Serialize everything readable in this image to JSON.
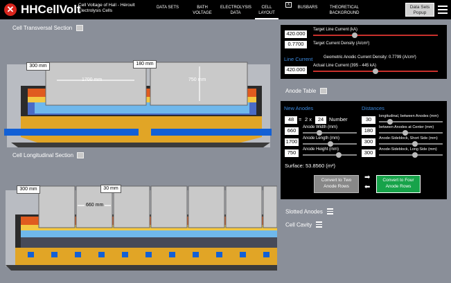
{
  "app": {
    "brand": "HHCellVolt",
    "subtitle": "Cell Voltage of Hall - Héroult Electrolysis Cells"
  },
  "nav": {
    "tabs": [
      {
        "label": "DATA SETS"
      },
      {
        "label": "BATH VOLTAGE"
      },
      {
        "label": "ELECTROLYSIS DATA"
      },
      {
        "label": "CELL LAYOUT"
      },
      {
        "label": "BUSBARS"
      },
      {
        "label": "THEORETICAL BACKGROUND"
      }
    ],
    "close_label": "X",
    "popup_button": "Data Sets Popup"
  },
  "transversal": {
    "title": "Cell Transversal Section",
    "dims": {
      "left_gap": "300 mm",
      "center_gap": "180 mm",
      "anode_width": "1700 mm",
      "anode_height": "750 mm"
    }
  },
  "longitudinal": {
    "title": "Cell Longitudinal Section",
    "dims": {
      "end_gap": "300 mm",
      "between_gap": "30 mm",
      "anode_length": "660 mm"
    }
  },
  "current_panel": {
    "line_current": {
      "value": "420.000",
      "label": "Target Line Current (kA)",
      "fill": 0.65
    },
    "current_density": {
      "value": "0.7700",
      "label": "Target Current Density (A/cm²)",
      "fill": 0.45
    },
    "mode_label": "Line Current",
    "geo_density": "Geometric Anodic Current Density: 0.7799 (A/cm²)",
    "actual": {
      "value": "420.000",
      "label": "Actual Line Current (395 - 445 kA)",
      "fill": 0.5
    }
  },
  "anode_table": {
    "title": "Anode Table",
    "new_anodes_title": "New Anodes",
    "distances_title": "Distances",
    "count_a": "48",
    "equals": "=",
    "times": "2 x",
    "count_b": "24",
    "number_label": "Number",
    "width": {
      "value": "660",
      "label": "Anode Width (mm)",
      "fill": 0.3
    },
    "length": {
      "value": "1700",
      "label": "Anode Length (mm)",
      "fill": 0.5
    },
    "height": {
      "value": "750",
      "label": "Anode Height (mm)",
      "fill": 0.65
    },
    "dist_long": {
      "value": "30",
      "label": "longitudinal, between Anodes (mm)",
      "fill": 0.15
    },
    "dist_center": {
      "value": "180",
      "label": "between Anodes at Center (mm)",
      "fill": 0.4
    },
    "dist_short": {
      "value": "300",
      "label": "Anode-Sideblock, Short Side (mm)",
      "fill": 0.55
    },
    "dist_long_side": {
      "value": "300",
      "label": "Anode-Sideblock, Long Side (mm)",
      "fill": 0.55
    },
    "surface": "Surface: 53.8560 (m²)",
    "btn_two": "Convert to Two Anode Rows",
    "btn_four": "Convert to Four Anode Rows"
  },
  "side_items": [
    {
      "label": "Slotted Anodes"
    },
    {
      "label": "Cell Cavity"
    }
  ],
  "colors": {
    "accent": "#3d8be0",
    "slider": "#c9302c",
    "green": "#17a34a"
  }
}
